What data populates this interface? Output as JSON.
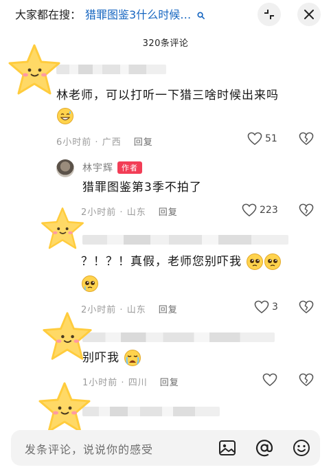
{
  "header": {
    "search_prefix": "大家都在搜：",
    "search_query": "猎罪图鉴3什么时候…",
    "comment_count": "320条评论"
  },
  "comments": [
    {
      "text": "林老师，可以打听一下猎三啥时候出来吗",
      "time": "6小时前",
      "location": "广西",
      "reply_label": "回复",
      "likes": "51"
    },
    {
      "author": "林宇辉",
      "badge": "作者",
      "text": "猎罪图鉴第3季不拍了",
      "time": "2小时前",
      "location": "山东",
      "reply_label": "回复",
      "likes": "223"
    },
    {
      "text": "？！？！真假，老师您别吓我",
      "time": "2小时前",
      "location": "山东",
      "reply_label": "回复",
      "likes": "3"
    },
    {
      "text": "别吓我",
      "time": "1小时前",
      "location": "四川",
      "reply_label": "回复",
      "likes": ""
    }
  ],
  "input": {
    "placeholder": "发条评论，说说你的感受"
  },
  "colors": {
    "search_query": "#1565c0",
    "author_badge": "#f23d56",
    "star_fill": "#ffd966",
    "star_cheek": "#ff9aa2"
  }
}
